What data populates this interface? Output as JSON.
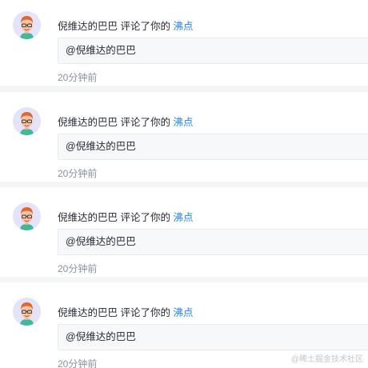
{
  "notifications": [
    {
      "user": "倪维达的巴巴",
      "action": " 评论了你的 ",
      "target": "沸点",
      "quote": "@倪维达的巴巴",
      "time": "20分钟前"
    },
    {
      "user": "倪维达的巴巴",
      "action": " 评论了你的 ",
      "target": "沸点",
      "quote": "@倪维达的巴巴",
      "time": "20分钟前"
    },
    {
      "user": "倪维达的巴巴",
      "action": " 评论了你的 ",
      "target": "沸点",
      "quote": "@倪维达的巴巴",
      "time": "20分钟前"
    },
    {
      "user": "倪维达的巴巴",
      "action": " 评论了你的 ",
      "target": "沸点",
      "quote": "@倪维达的巴巴",
      "time": "20分钟前"
    }
  ],
  "watermark": "@稀土掘金技术社区",
  "colors": {
    "link": "#1e80ff",
    "text": "#252933",
    "muted": "#8a919f",
    "page_bg": "#f4f5f5"
  },
  "avatar_icon": "cartoon-boy-avatar-icon"
}
